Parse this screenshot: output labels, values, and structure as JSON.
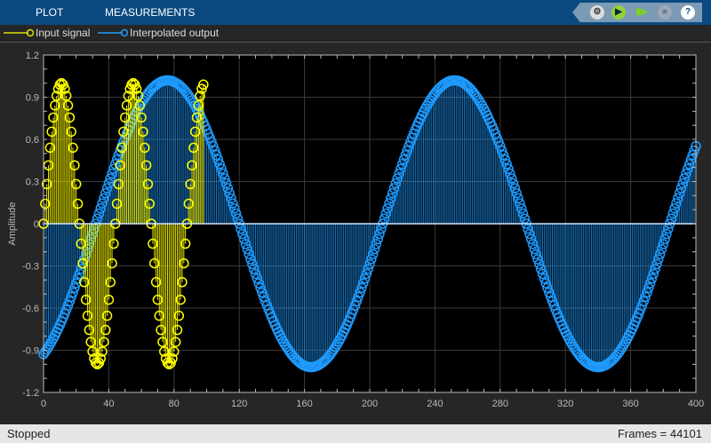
{
  "toolbar": {
    "tabs": [
      "PLOT",
      "MEASUREMENTS"
    ],
    "icons": [
      "settings-icon",
      "run-icon",
      "step-forward-icon",
      "stop-icon",
      "help-icon"
    ],
    "help_label": "?"
  },
  "legend": {
    "items": [
      {
        "label": "Input signal",
        "color": "#ffff00"
      },
      {
        "label": "Interpolated output",
        "color": "#1e9bff"
      }
    ]
  },
  "status": {
    "state": "Stopped",
    "frames": "Frames = 44101"
  },
  "chart_data": {
    "type": "stem",
    "title": "",
    "xlabel": "",
    "ylabel": "Amplitude",
    "xlim": [
      0,
      400
    ],
    "ylim": [
      -1.2,
      1.2
    ],
    "xticks": [
      "0",
      "40",
      "80",
      "120",
      "160",
      "200",
      "240",
      "280",
      "320",
      "360",
      "400"
    ],
    "yticks": [
      "1.2",
      "0.9",
      "0.6",
      "0.3",
      "0",
      "-0.3",
      "-0.6",
      "-0.9",
      "-1.2"
    ],
    "grid": true,
    "legend_position": "top-left",
    "series": [
      {
        "name": "Input signal",
        "color": "#ffff00",
        "kind": "sinusoid",
        "x_range": [
          0,
          98
        ],
        "x_step": 1,
        "amplitude": 1.0,
        "period": 44,
        "zero_crossing_rising": 0
      },
      {
        "name": "Interpolated output",
        "color": "#1e9bff",
        "kind": "sinusoid",
        "x_range": [
          0,
          400
        ],
        "x_step": 1,
        "amplitude": 1.02,
        "period": 176,
        "zero_crossing_rising": 32
      }
    ]
  }
}
